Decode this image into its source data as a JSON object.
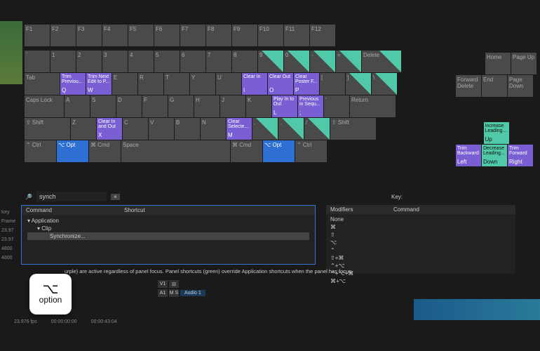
{
  "keyboard": {
    "row_fn": [
      {
        "l": "F1"
      },
      {
        "l": "F2"
      },
      {
        "l": "F3"
      },
      {
        "l": "F4"
      },
      {
        "l": "F5"
      },
      {
        "l": "F6"
      },
      {
        "l": "F7"
      },
      {
        "l": "F8"
      },
      {
        "l": "F9"
      },
      {
        "l": "F10"
      },
      {
        "l": "F11"
      },
      {
        "l": "F12"
      }
    ],
    "row_num": [
      {
        "l": "`"
      },
      {
        "l": "1"
      },
      {
        "l": "2"
      },
      {
        "l": "3"
      },
      {
        "l": "4"
      },
      {
        "l": "5"
      },
      {
        "l": "6"
      },
      {
        "l": "7"
      },
      {
        "l": "8"
      },
      {
        "l": "9",
        "g": true
      },
      {
        "l": "0",
        "g": true
      },
      {
        "l": "-",
        "g": true
      },
      {
        "l": "=",
        "g": true
      },
      {
        "l": "Delete",
        "g": true,
        "w": "w56"
      }
    ],
    "row_q": [
      {
        "l": "Tab",
        "w": "w50"
      },
      {
        "l": "Q",
        "t": "Trim Previou...",
        "p": true
      },
      {
        "l": "W",
        "t": "Trim Next Edit to P...",
        "p": true
      },
      {
        "l": "E"
      },
      {
        "l": "R"
      },
      {
        "l": "T"
      },
      {
        "l": "Y"
      },
      {
        "l": "U"
      },
      {
        "l": "I",
        "t": "Clear In",
        "p": true
      },
      {
        "l": "O",
        "t": "Clear Out",
        "p": true
      },
      {
        "l": "P",
        "t": "Clear Poster F...",
        "p": true
      },
      {
        "l": "["
      },
      {
        "l": "]",
        "g": true
      },
      {
        "l": "\\",
        "g": true
      }
    ],
    "row_a": [
      {
        "l": "Caps Lock",
        "w": "w56"
      },
      {
        "l": "A"
      },
      {
        "l": "S"
      },
      {
        "l": "D"
      },
      {
        "l": "F"
      },
      {
        "l": "G"
      },
      {
        "l": "H"
      },
      {
        "l": "J"
      },
      {
        "l": "K"
      },
      {
        "l": "L",
        "t": "Play In to Out",
        "p": true
      },
      {
        "l": ";",
        "t": "Previous in Sequ...",
        "p": true
      },
      {
        "l": "'"
      },
      {
        "l": "Return",
        "w": "w65"
      }
    ],
    "row_z": [
      {
        "l": "⇧ Shift",
        "w": "w65"
      },
      {
        "l": "Z"
      },
      {
        "l": "X",
        "t": "Clear In and Out",
        "p": true
      },
      {
        "l": "C"
      },
      {
        "l": "V"
      },
      {
        "l": "B"
      },
      {
        "l": "N"
      },
      {
        "l": "M",
        "t": "Clear Selecte...",
        "p": true
      },
      {
        "l": ",",
        "g": true
      },
      {
        "l": ".",
        "g": true
      },
      {
        "l": "/",
        "g": true
      },
      {
        "l": "⇧ Shift",
        "w": "w65"
      }
    ],
    "row_mod": [
      {
        "l": "⌃ Ctrl",
        "w": "w45"
      },
      {
        "l": "⌥ Opt",
        "w": "w45",
        "b": true
      },
      {
        "l": "⌘ Cmd",
        "w": "w45"
      },
      {
        "l": "Space",
        "w": "w110"
      },
      {
        "l": "⌘ Cmd",
        "w": "w45"
      },
      {
        "l": "⌥ Opt",
        "w": "w45",
        "b": true
      },
      {
        "l": "⌃ Ctrl",
        "w": "w45"
      }
    ],
    "nav1": [
      {
        "l": "Home"
      },
      {
        "l": "Page Up"
      }
    ],
    "nav2": [
      {
        "l": "Forward Delete"
      },
      {
        "l": "End"
      },
      {
        "l": "Page Down"
      }
    ],
    "arrows_top": [
      {
        "l": "Up",
        "t": "Increase Leading...",
        "gn": true
      }
    ],
    "arrows_bot": [
      {
        "l": "Left",
        "t": "Trim Backward",
        "p": true
      },
      {
        "l": "Down",
        "t": "Decrease Leading...",
        "gn": true
      },
      {
        "l": "Right",
        "t": "Trim Forward",
        "p": true
      }
    ]
  },
  "search": {
    "placeholder": "synch",
    "value": "synch",
    "key_label": "Key:"
  },
  "columns": {
    "cmd": "Command",
    "shortcut": "Shortcut",
    "mods": "Modifiers",
    "cmd2": "Command"
  },
  "tree": {
    "app": "Application",
    "clip": "Clip",
    "sync": "Synchronize..."
  },
  "mods": [
    "None",
    "⌘",
    "⇧",
    "⌥",
    "⌃",
    "⇧+⌘",
    "⌃+⌥",
    "⌃+⌥+⌘",
    "⌘+⌥"
  ],
  "hint": "urple) are active regardless of panel focus. Panel shortcuts (green) override Application shortcuts when the panel has focus.",
  "float": {
    "symbol": "⌥",
    "label": "option"
  },
  "sidebar_labels": [
    "tory",
    "Frame",
    "23.97",
    "23.97",
    "4800",
    "4800"
  ],
  "timeline": {
    "v1": "V1",
    "a1": "A1",
    "ms": "M S",
    "audio": "Audio 1"
  },
  "stats": {
    "fps": "23.976 fps",
    "tc": "00:00:00:00",
    "tc2": "00:00:43:04"
  }
}
